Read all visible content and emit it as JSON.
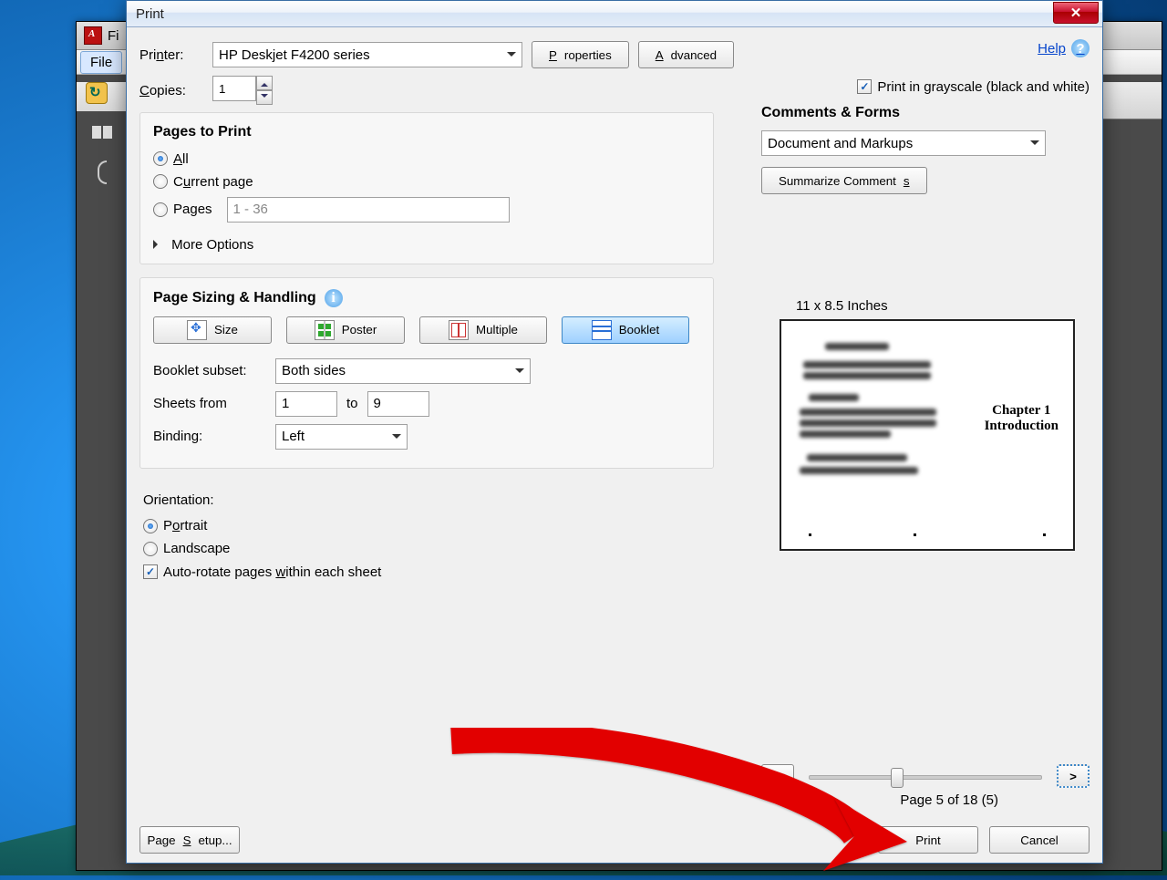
{
  "parent": {
    "title_fragment": "Fi",
    "menu_file": "File"
  },
  "dialog": {
    "title": "Print",
    "help": "Help",
    "printer_label": "Printer:",
    "printer_value": "HP Deskjet F4200 series",
    "properties": "Properties",
    "advanced": "Advanced",
    "copies_label": "Copies:",
    "copies_value": "1",
    "grayscale": "Print in grayscale (black and white)"
  },
  "pages": {
    "heading": "Pages to Print",
    "all": "All",
    "current": "Current page",
    "pages": "Pages",
    "range_placeholder": "1 - 36",
    "more": "More Options"
  },
  "handling": {
    "heading": "Page Sizing & Handling",
    "size": "Size",
    "poster": "Poster",
    "multiple": "Multiple",
    "booklet": "Booklet",
    "subset_label": "Booklet subset:",
    "subset_value": "Both sides",
    "sheets_from": "Sheets from",
    "sheets_from_val": "1",
    "to": "to",
    "sheets_to_val": "9",
    "binding_label": "Binding:",
    "binding_value": "Left"
  },
  "orientation": {
    "heading": "Orientation:",
    "portrait": "Portrait",
    "landscape": "Landscape",
    "autorotate": "Auto-rotate pages within each sheet"
  },
  "comments": {
    "heading": "Comments & Forms",
    "value": "Document and Markups",
    "summarize": "Summarize Comments"
  },
  "preview": {
    "dims": "11 x 8.5 Inches",
    "chapter_line1": "Chapter 1",
    "chapter_line2": "Introduction",
    "prev": "<",
    "next": ">",
    "page_info": "Page 5 of 18 (5)"
  },
  "footer": {
    "page_setup": "Page Setup...",
    "print": "Print",
    "cancel": "Cancel"
  }
}
